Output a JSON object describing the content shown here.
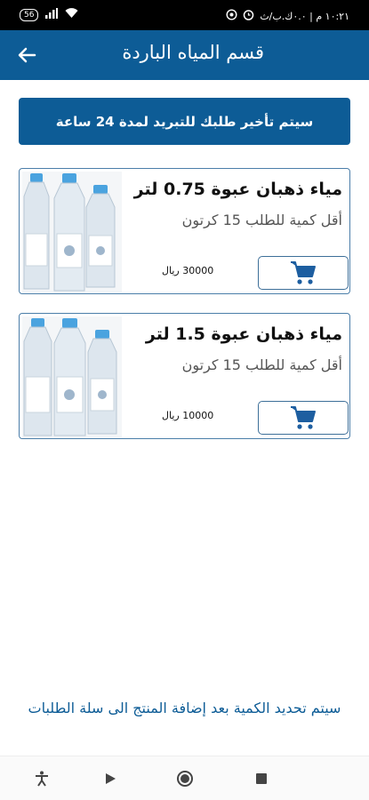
{
  "status": {
    "time": "١٠:٢١ م | ٠.٠ك.ب/ث",
    "battery": "56"
  },
  "header": {
    "title": "قسم المياه الباردة"
  },
  "notice": {
    "text": "سيتم تأخير طلبك للتبريد لمدة 24 ساعة"
  },
  "products": [
    {
      "name": "مياء ذهبان عبوة 0.75 لتر",
      "min_order": "أقل كمية للطلب 15 كرتون",
      "price": "30000 ريال"
    },
    {
      "name": "مياء ذهبان عبوة 1.5 لتر",
      "min_order": "أقل كمية للطلب 15 كرتون",
      "price": "10000 ريال"
    }
  ],
  "footer": {
    "note": "سيتم تحديد الكمية بعد إضافة المنتج الى سلة الطلبات"
  },
  "colors": {
    "primary": "#0d5c96",
    "cart": "#1d5ea0"
  },
  "icons": {
    "back": "arrow-left-icon",
    "cart": "shopping-cart-icon",
    "nav": [
      "accessibility-icon",
      "back-triangle-icon",
      "home-circle-icon",
      "recents-square-icon"
    ]
  }
}
